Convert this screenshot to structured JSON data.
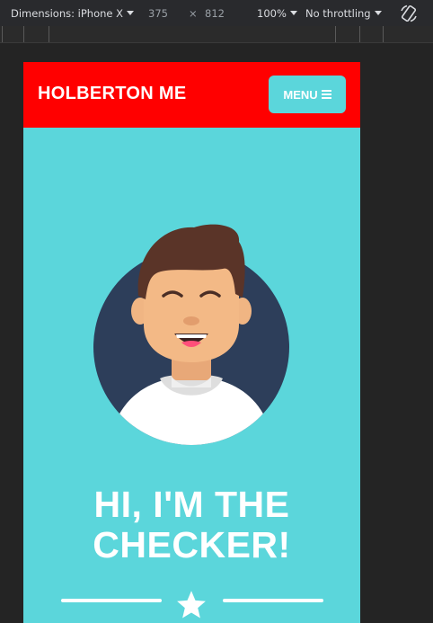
{
  "devtools": {
    "dimensions_label": "Dimensions: iPhone X",
    "width": "375",
    "times": "×",
    "height": "812",
    "zoom": "100%",
    "throttling": "No throttling",
    "rotate_icon": "rotate-icon"
  },
  "navbar": {
    "brand": "HOLBERTON ME",
    "menu_label": "MENU",
    "menu_icon": "hamburger-icon",
    "bg_color": "#ff0000"
  },
  "hero": {
    "headline_line1": "HI, I'M THE",
    "headline_line2": "CHECKER!",
    "avatar_icon": "avatar-illustration",
    "divider_icon": "star-icon",
    "bg_color": "#5bd6db"
  }
}
